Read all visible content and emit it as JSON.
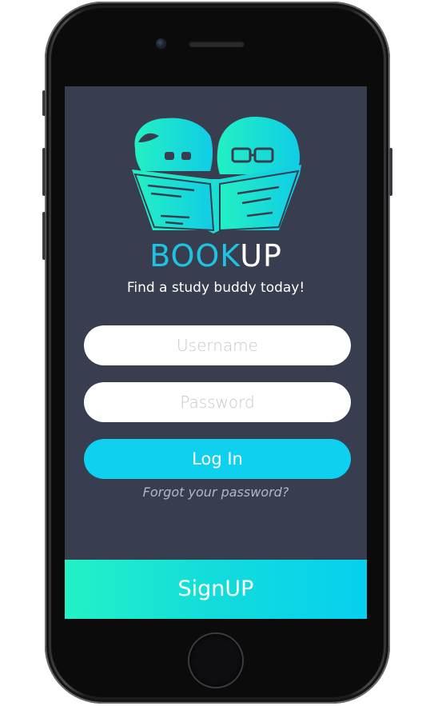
{
  "app": {
    "brand_part1": "BOOK",
    "brand_part2": "UP",
    "tagline": "Find a study buddy today!"
  },
  "login_form": {
    "username_placeholder": "Username",
    "password_placeholder": "Password",
    "login_label": "Log In",
    "forgot_label": "Forgot your password?"
  },
  "signup": {
    "label": "SignUP"
  },
  "colors": {
    "background": "#383e4f",
    "accent": "#0fd0ef",
    "brand_teal": "#1cc3e3",
    "signup_gradient_start": "#22f2c6",
    "signup_gradient_end": "#06d0f0"
  },
  "icons": {
    "logo": "two-kids-reading-book-logo"
  }
}
